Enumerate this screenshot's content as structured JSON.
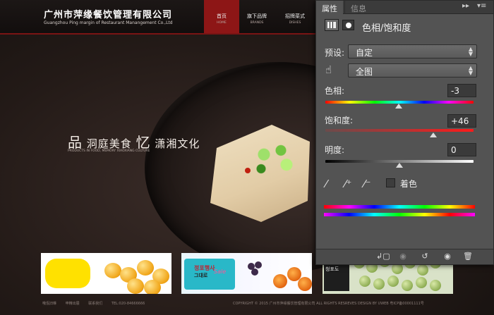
{
  "website": {
    "company_name": "广州市萍缘餐饮管理有限公司",
    "company_en": "Guangzhou Ping margin of  Restaurant Manangement Co.,Ltd",
    "nav": [
      {
        "zh": "首页",
        "en": "HOME"
      },
      {
        "zh": "旗下品牌",
        "en": "BRANDS"
      },
      {
        "zh": "招牌菜式",
        "en": "DISHES"
      }
    ],
    "slogan": {
      "char1": "品",
      "text1": "洞庭美食",
      "char2": "忆",
      "text2": "潇湘文化",
      "sub": "PRODUCTS IN FOOD, MEMORY XIAOXIANG CULTURE"
    },
    "thumbs": [
      {
        "name": "fruit-promo"
      },
      {
        "name": "sale-promo",
        "text": "정포행사",
        "text2": "그대로",
        "en": "Sale"
      },
      {
        "name": "grape-promo",
        "text": "청포도"
      }
    ],
    "footer_links": [
      "哦佤旧琳",
      "申精出展",
      "联系我们",
      "TEL:020-84666666"
    ],
    "copyright": "COPYRIGHT © 2015  广州市萍缘餐饮管理有限公司  ALL RIGHTS RESREVES  DESIGN BY UWEB  粤ICP备00001111号"
  },
  "panel": {
    "tabs": [
      "属性",
      "信息"
    ],
    "title": "色相/饱和度",
    "preset_label": "预设:",
    "preset_value": "自定",
    "range_value": "全图",
    "hue_label": "色相:",
    "hue_value": "-3",
    "hue_fraction": 0.493,
    "saturation_label": "饱和度:",
    "saturation_value": "+46",
    "saturation_fraction": 0.73,
    "lightness_label": "明度:",
    "lightness_value": "0",
    "lightness_fraction": 0.5,
    "colorize_label": "着色",
    "colorize_checked": false,
    "icons": [
      "adjustment-layer-icon",
      "mask-icon",
      "hand-target-icon",
      "eyedropper-icon",
      "eyedropper-plus-icon",
      "eyedropper-minus-icon",
      "clip-to-layer-icon",
      "view-previous-icon",
      "reset-icon",
      "visibility-eye-icon",
      "trash-icon"
    ]
  }
}
